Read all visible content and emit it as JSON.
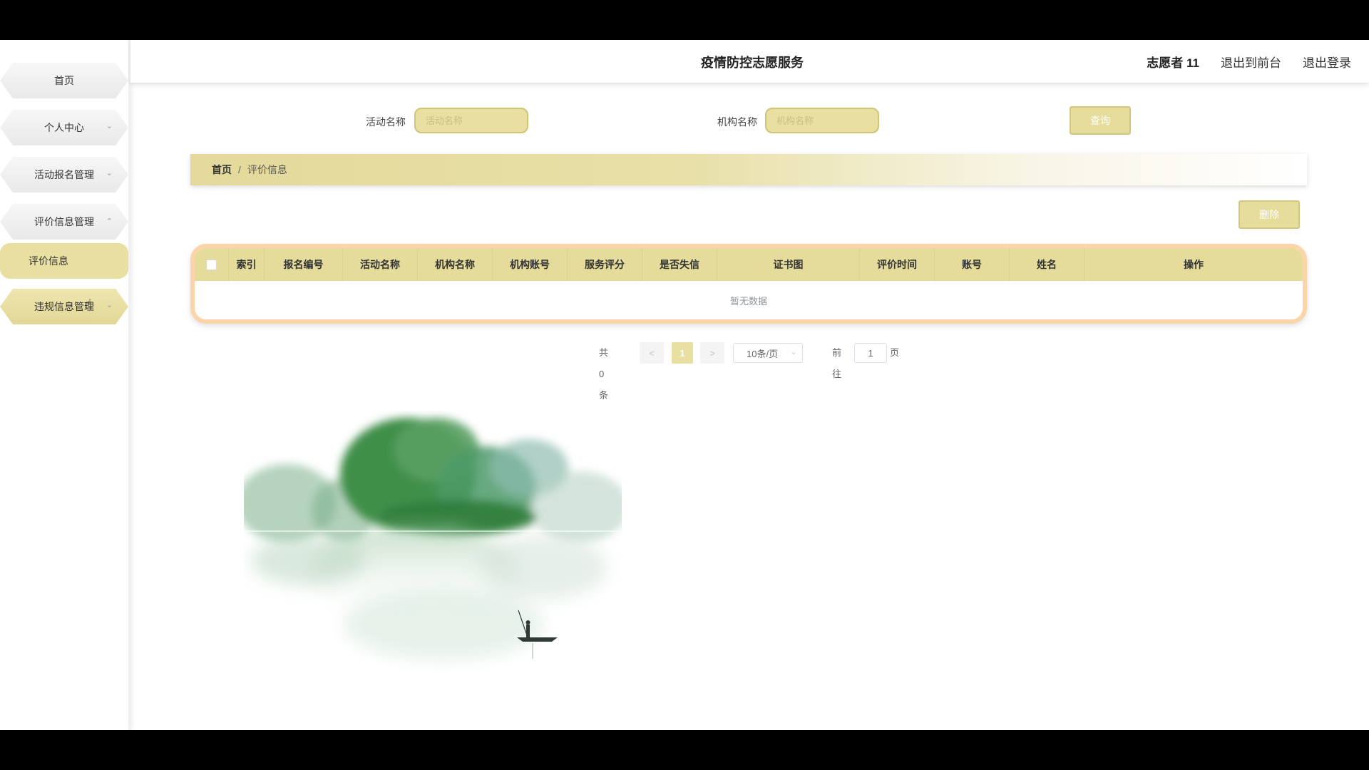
{
  "app": {
    "title": "疫情防控志愿服务",
    "user": "志愿者 11",
    "links": [
      "退出到前台",
      "退出登录"
    ]
  },
  "sidebar": {
    "items": [
      {
        "label": "首页",
        "expandable": false
      },
      {
        "label": "个人中心",
        "expandable": true
      },
      {
        "label": "活动报名管理",
        "expandable": true
      },
      {
        "label": "评价信息管理",
        "expandable": true,
        "expanded": true
      },
      {
        "label": "违规信息管理",
        "expandable": true
      }
    ],
    "active_sub": "评价信息"
  },
  "search": {
    "activity_label": "活动名称",
    "activity_placeholder": "活动名称",
    "org_label": "机构名称",
    "org_placeholder": "机构名称",
    "query_btn": "查询"
  },
  "breadcrumb": {
    "home": "首页",
    "sep": "/",
    "current": "评价信息"
  },
  "actions": {
    "delete": "删除"
  },
  "table": {
    "columns": [
      "索引",
      "报名编号",
      "活动名称",
      "机构名称",
      "机构账号",
      "服务评分",
      "是否失信",
      "证书图",
      "评价时间",
      "账号",
      "姓名",
      "操作"
    ],
    "empty": "暂无数据"
  },
  "pagination": {
    "total": "共 0 条",
    "prev": "<",
    "page": "1",
    "next": ">",
    "size": "10条/页",
    "goto_label": "前往",
    "goto_value": "1",
    "goto_suffix": "页"
  },
  "colors": {
    "accent": "#e5db9b",
    "accent_border": "#d3c67f",
    "table_border": "#fbd5a8"
  }
}
